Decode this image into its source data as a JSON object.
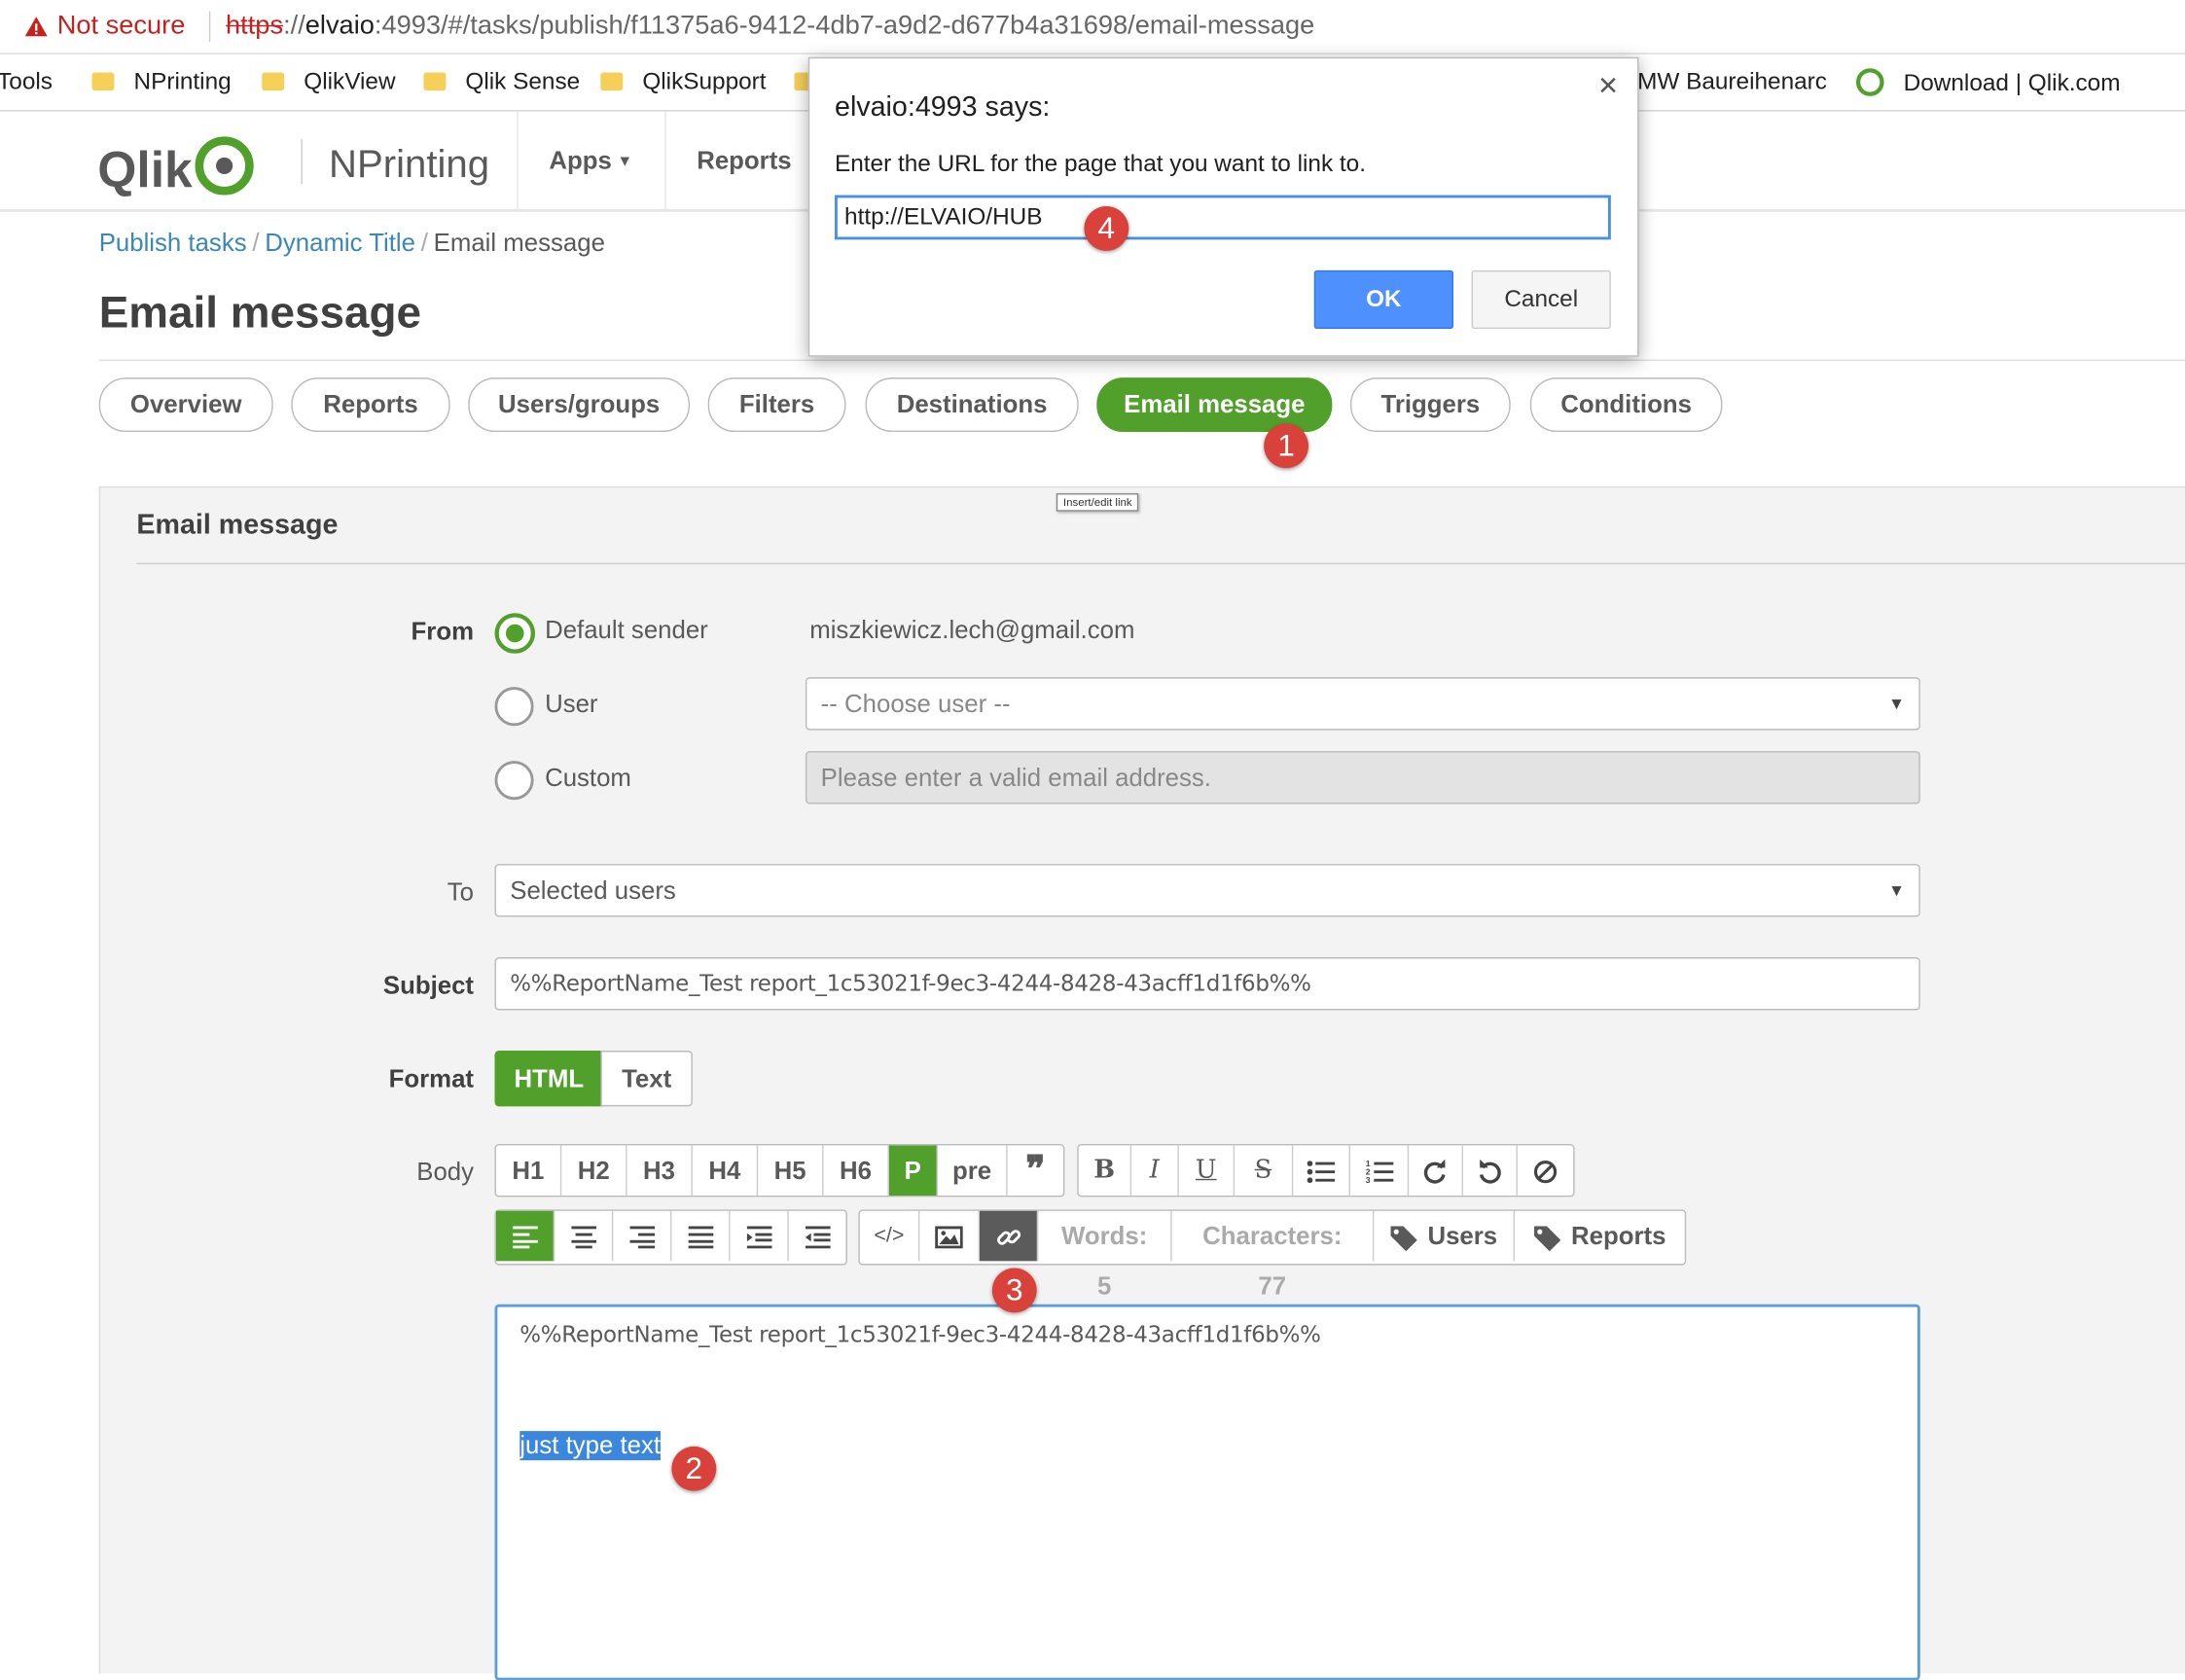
{
  "browser": {
    "not_secure": "Not secure",
    "url_scheme": "https",
    "url_host": "elvaio",
    "url_rest": ":4993/#/tasks/publish/f11375a6-9412-4db7-a9d2-d677b4a31698/email-message",
    "bookmarks": [
      "Tools",
      "NPrinting",
      "QlikView",
      "Qlik Sense",
      "QlikSupport",
      "MW Baureihenarchi",
      "Download | Qlik.com"
    ]
  },
  "header": {
    "logo": "Qlik",
    "product": "NPrinting",
    "nav": [
      "Apps",
      "Reports"
    ]
  },
  "breadcrumb": {
    "items": [
      "Publish tasks",
      "Dynamic Title"
    ],
    "current": "Email message",
    "sep": "/"
  },
  "page_title": "Email message",
  "tabs": [
    "Overview",
    "Reports",
    "Users/groups",
    "Filters",
    "Destinations",
    "Email message",
    "Triggers",
    "Conditions"
  ],
  "active_tab": "Email message",
  "tooltip": "Insert/edit link",
  "panel": {
    "title": "Email message",
    "from_label": "From",
    "from_options": [
      "Default sender",
      "User",
      "Custom"
    ],
    "default_sender_email": "miszkiewicz.lech@gmail.com",
    "choose_user_placeholder": "-- Choose user --",
    "custom_placeholder": "Please enter a valid email address.",
    "to_label": "To",
    "to_value": "Selected users",
    "subject_label": "Subject",
    "subject_value": "%%ReportName_Test report_1c53021f-9ec3-4244-8428-43acff1d1f6b%%",
    "format_label": "Format",
    "format_options": [
      "HTML",
      "Text"
    ],
    "body_label": "Body",
    "toolbar_headings": [
      "H1",
      "H2",
      "H3",
      "H4",
      "H5",
      "H6",
      "P",
      "pre"
    ],
    "words": "Words: 5",
    "characters": "Characters: 77",
    "users_btn": "Users",
    "reports_btn": "Reports",
    "editor_line1": "%%ReportName_Test report_1c53021f-9ec3-4244-8428-43acff1d1f6b%%",
    "editor_selected": "just type text"
  },
  "dialog": {
    "title": "elvaio:4993 says:",
    "message": "Enter the URL for the page that you want to link to.",
    "input_value": "http://ELVAIO/HUB",
    "ok": "OK",
    "cancel": "Cancel",
    "close": "×"
  },
  "markers": [
    "1",
    "2",
    "3",
    "4"
  ],
  "colors": {
    "accent": "#52a02c",
    "link": "#3a88b5",
    "marker": "#d9413b",
    "ok_button": "#4d90fe"
  }
}
